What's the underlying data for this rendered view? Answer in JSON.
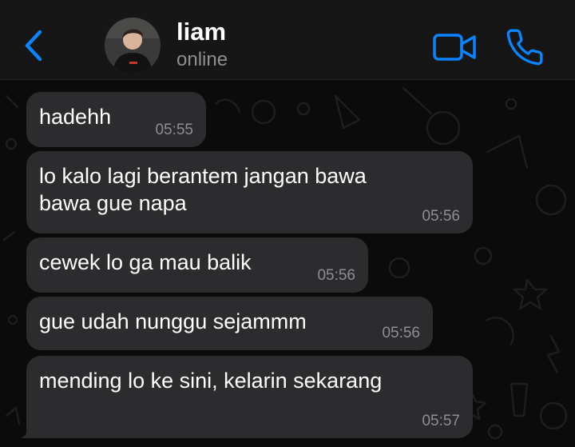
{
  "header": {
    "contact_name": "liam",
    "contact_status": "online"
  },
  "icons": {
    "back": "chevron-left-icon",
    "video": "video-camera-icon",
    "call": "phone-icon"
  },
  "colors": {
    "accent": "#0a84ff",
    "bubble": "#2c2c2e",
    "background": "#0b0b0b",
    "header": "#161616",
    "timestamp": "#8e8e93"
  },
  "messages": [
    {
      "text": "hadehh",
      "time": "05:55"
    },
    {
      "text": "lo kalo lagi berantem jangan bawa\nbawa gue napa",
      "time": "05:56"
    },
    {
      "text": "cewek lo ga mau balik",
      "time": "05:56"
    },
    {
      "text": "gue udah nunggu sejammm",
      "time": "05:56"
    },
    {
      "text": "mending lo ke sini, kelarin sekarang",
      "time": "05:57"
    }
  ]
}
